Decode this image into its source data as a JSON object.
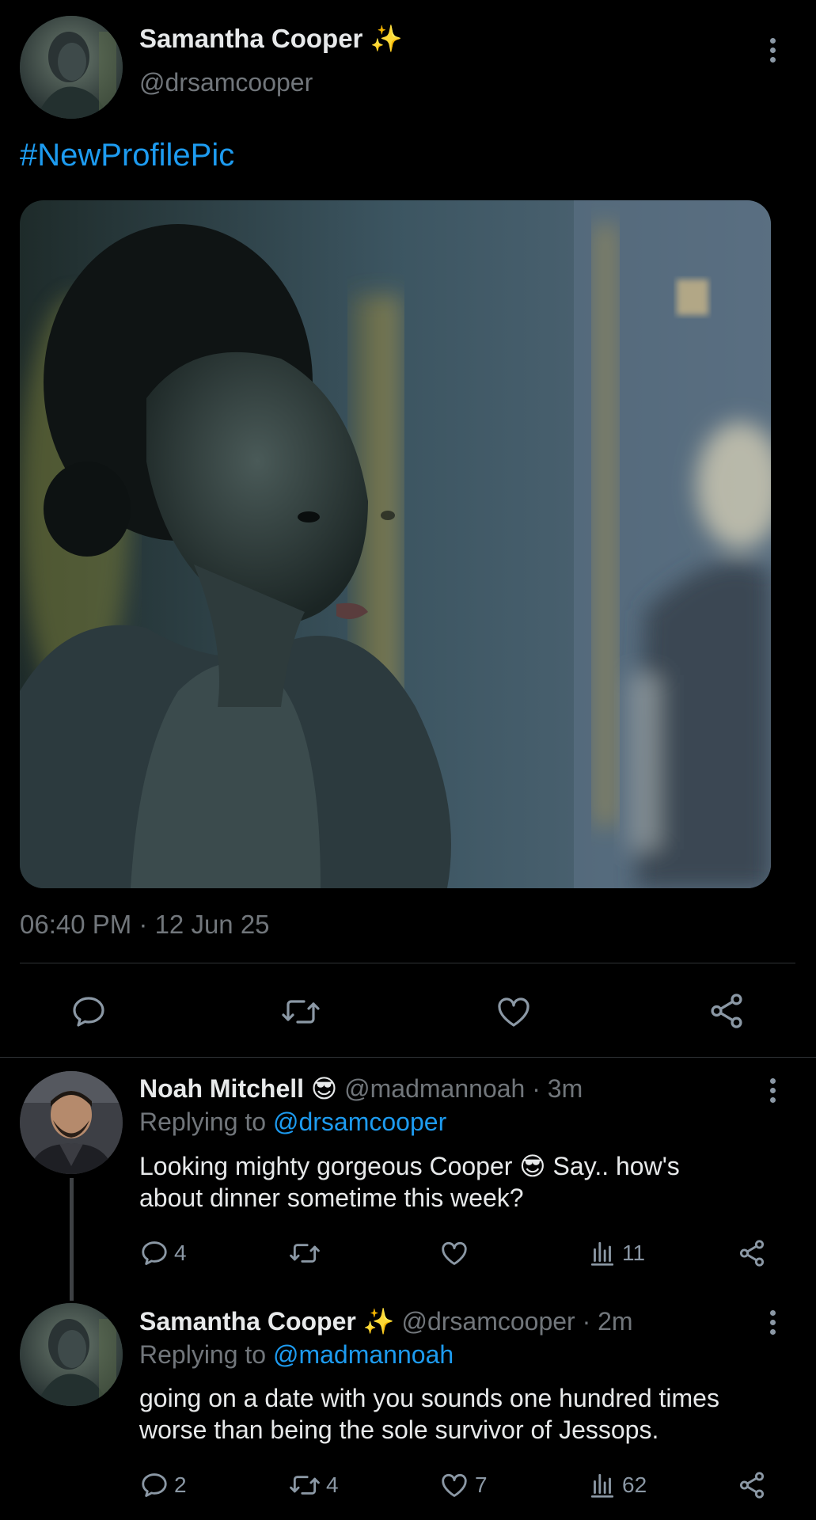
{
  "main_tweet": {
    "author_name": "Samantha Cooper",
    "author_emoji": "✨",
    "handle": "@drsamcooper",
    "hashtag": "#NewProfilePic",
    "timestamp": "06:40 PM · 12 Jun 25"
  },
  "replies": [
    {
      "author_name": "Noah Mitchell",
      "author_emoji": "😎",
      "handle_time": "@madmannoah · 3m",
      "replying_prefix": "Replying to ",
      "replying_to": "@drsamcooper",
      "text_line1": "Looking mighty gorgeous Cooper 😎 Say.. how's",
      "text_line2": "about dinner sometime this week?",
      "reply_count": "4",
      "retweet_count": "",
      "like_count": "",
      "view_count": "11"
    },
    {
      "author_name": "Samantha Cooper",
      "author_emoji": "✨",
      "handle_time": "@drsamcooper · 2m",
      "replying_prefix": "Replying to ",
      "replying_to": "@madmannoah",
      "text_line1": "going on a date with you sounds one hundred times",
      "text_line2": "worse than being the sole survivor of Jessops.",
      "reply_count": "2",
      "retweet_count": "4",
      "like_count": "7",
      "view_count": "62"
    }
  ],
  "colors": {
    "background": "#000000",
    "text": "#e7e9ea",
    "muted": "#71767b",
    "link": "#1d9bf0",
    "divider": "#2f3336"
  },
  "icons": [
    "more-icon",
    "reply-icon",
    "retweet-icon",
    "like-icon",
    "share-icon",
    "views-icon"
  ]
}
